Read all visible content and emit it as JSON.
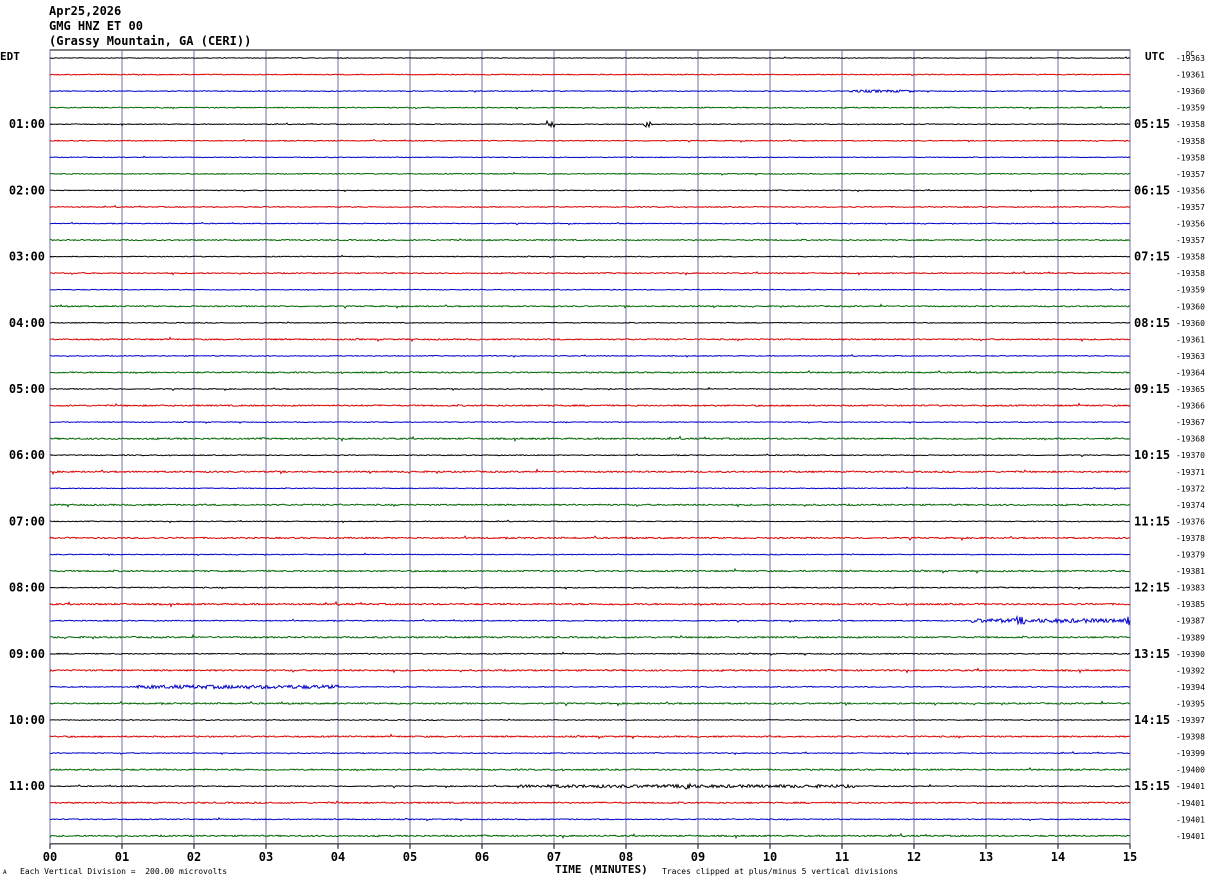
{
  "header": {
    "date": "Apr25,2026",
    "channel": "GMG HNZ ET 00",
    "station": "(Grassy Mountain, GA (CERI))"
  },
  "left_tz": "EDT",
  "right_tz": "UTC",
  "dc_label": "DC",
  "footer": {
    "scale": "Each Vertical Division =  200.00 microvolts",
    "clip": "Traces clipped at plus/minus 5 vertical divisions",
    "mark": "A"
  },
  "colors": {
    "black": "#000000",
    "red": "#dd0000",
    "blue": "#0000cc",
    "green": "#006600",
    "grid": "#7070a0"
  },
  "chart_data": {
    "type": "line",
    "subtype": "helicorder",
    "xlabel": "TIME (MINUTES)",
    "xlim": [
      0,
      15
    ],
    "x_ticks": [
      "00",
      "01",
      "02",
      "03",
      "04",
      "05",
      "06",
      "07",
      "08",
      "09",
      "10",
      "11",
      "12",
      "13",
      "14",
      "15"
    ],
    "minutes_per_line": 15,
    "line_count": 48,
    "color_cycle": [
      "black",
      "red",
      "blue",
      "green"
    ],
    "left_labels": [
      "01:00",
      "02:00",
      "03:00",
      "04:00",
      "05:00",
      "06:00",
      "07:00",
      "08:00",
      "09:00",
      "10:00",
      "11:00"
    ],
    "right_labels": [
      "05:15",
      "06:15",
      "07:15",
      "08:15",
      "09:15",
      "10:15",
      "11:15",
      "12:15",
      "13:15",
      "14:15",
      "15:15"
    ],
    "label_line_start": 4,
    "label_line_step": 4,
    "dc_offsets": [
      -19363,
      -19361,
      -19360,
      -19359,
      -19358,
      -19358,
      -19358,
      -19357,
      -19356,
      -19357,
      -19356,
      -19357,
      -19358,
      -19358,
      -19359,
      -19360,
      -19360,
      -19361,
      -19363,
      -19364,
      -19365,
      -19366,
      -19367,
      -19368,
      -19370,
      -19371,
      -19372,
      -19374,
      -19376,
      -19378,
      -19379,
      -19381,
      -19383,
      -19385,
      -19387,
      -19389,
      -19390,
      -19392,
      -19394,
      -19395,
      -19397,
      -19398,
      -19399,
      -19400,
      -19401,
      -19401,
      -19401,
      -19401
    ],
    "noise_level": [
      0.35,
      0.45,
      0.4,
      0.5,
      0.4,
      0.45,
      0.35,
      0.45,
      0.4,
      0.5,
      0.4,
      0.6,
      0.4,
      0.55,
      0.4,
      0.6,
      0.4,
      0.65,
      0.4,
      0.65,
      0.45,
      0.7,
      0.4,
      0.75,
      0.45,
      0.75,
      0.4,
      0.7,
      0.4,
      0.7,
      0.4,
      0.7,
      0.5,
      0.8,
      0.5,
      0.75,
      0.5,
      0.75,
      0.5,
      0.7,
      0.45,
      0.7,
      0.45,
      0.7,
      0.5,
      0.7,
      0.5,
      0.7
    ],
    "events": [
      {
        "line": 2,
        "start_min": 11.1,
        "end_min": 12.0,
        "amp": 1.2
      },
      {
        "line": 4,
        "start_min": 6.9,
        "end_min": 7.0,
        "amp": 5
      },
      {
        "line": 4,
        "start_min": 8.25,
        "end_min": 8.35,
        "amp": 3
      },
      {
        "line": 34,
        "start_min": 12.8,
        "end_min": 15.0,
        "amp": 2
      },
      {
        "line": 34,
        "start_min": 13.4,
        "end_min": 13.55,
        "amp": 4
      },
      {
        "line": 34,
        "start_min": 14.95,
        "end_min": 15.0,
        "amp": 5
      },
      {
        "line": 38,
        "start_min": 1.2,
        "end_min": 4.0,
        "amp": 1.8
      },
      {
        "line": 44,
        "start_min": 6.5,
        "end_min": 11.2,
        "amp": 1.5
      },
      {
        "line": 44,
        "start_min": 8.8,
        "end_min": 8.9,
        "amp": 5
      }
    ]
  }
}
